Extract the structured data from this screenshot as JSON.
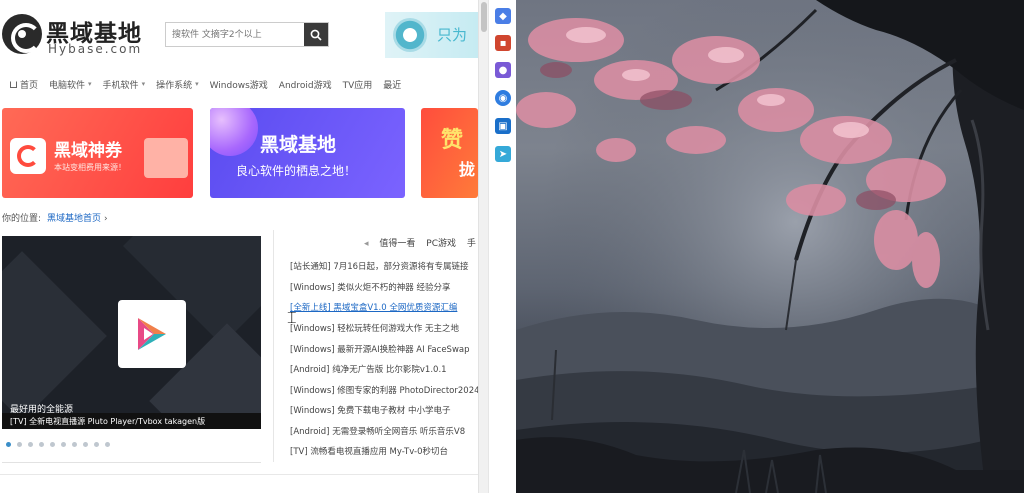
{
  "header": {
    "logo_text": "黑域基地",
    "logo_sub": "Hybase.com",
    "search_placeholder": "搜软件 文摘字2个以上",
    "top_banner_text": "只为"
  },
  "nav": {
    "items": [
      {
        "label": "首页",
        "caret": false
      },
      {
        "label": "电脑软件",
        "caret": true
      },
      {
        "label": "手机软件",
        "caret": true
      },
      {
        "label": "操作系统",
        "caret": true
      },
      {
        "label": "Windows游戏",
        "caret": false
      },
      {
        "label": "Android游戏",
        "caret": false
      },
      {
        "label": "TV应用",
        "caret": false
      },
      {
        "label": "最近",
        "caret": false
      }
    ]
  },
  "ads": {
    "ad1_title": "黑域神券",
    "ad1_sub": "本站变相费用来源！",
    "ad2_title": "黑域基地",
    "ad2_sub": "良心软件的栖息之地！",
    "ad3_title": "赞",
    "ad3_sub": "拢"
  },
  "breadcrumb": {
    "prefix": "你的位置:",
    "link": "黑域基地首页",
    "sep": "›"
  },
  "slider": {
    "caption": "最好用的全能源",
    "description": "[TV] 全新电视直播源 Pluto Player/Tvbox takagen版",
    "dot_count": 10,
    "active_dot": 0
  },
  "news": {
    "tabs": [
      "值得一看",
      "PC游戏",
      "手"
    ],
    "items": [
      {
        "text": "[站长通知] 7月16日起，部分资源将有专属链接",
        "link": false
      },
      {
        "text": "[Windows] 类似火炬不朽的神器 经验分享",
        "link": false
      },
      {
        "text": "[全新上线] 黑域宝盒V1.0 全网优质资源汇编",
        "link": true
      },
      {
        "text": "[Windows] 轻松玩转任何游戏大作 无主之地",
        "link": false
      },
      {
        "text": "[Windows] 最新开源AI换脸神器 AI FaceSwap",
        "link": false
      },
      {
        "text": "[Android] 纯净无广告版 比尔影院v1.0.1",
        "link": false
      },
      {
        "text": "[Windows] 修图专家的利器 PhotoDirector2024",
        "link": false
      },
      {
        "text": "[Windows] 免费下载电子教材 中小学电子",
        "link": false
      },
      {
        "text": "[Android] 无需登录畅听全网音乐 听乐音乐V8",
        "link": false
      },
      {
        "text": "[TV] 流畅看电视直播应用 My-Tv-0秒切台",
        "link": false
      }
    ]
  },
  "colors": {
    "link": "#1d68c4",
    "ad1": "#ff4b3e",
    "ad2": "#6a55f5",
    "slider_bg": "#1d2128"
  },
  "extensions": [
    "tag-icon",
    "briefcase-icon",
    "person-icon",
    "copilot-icon",
    "outlook-icon",
    "send-icon"
  ]
}
